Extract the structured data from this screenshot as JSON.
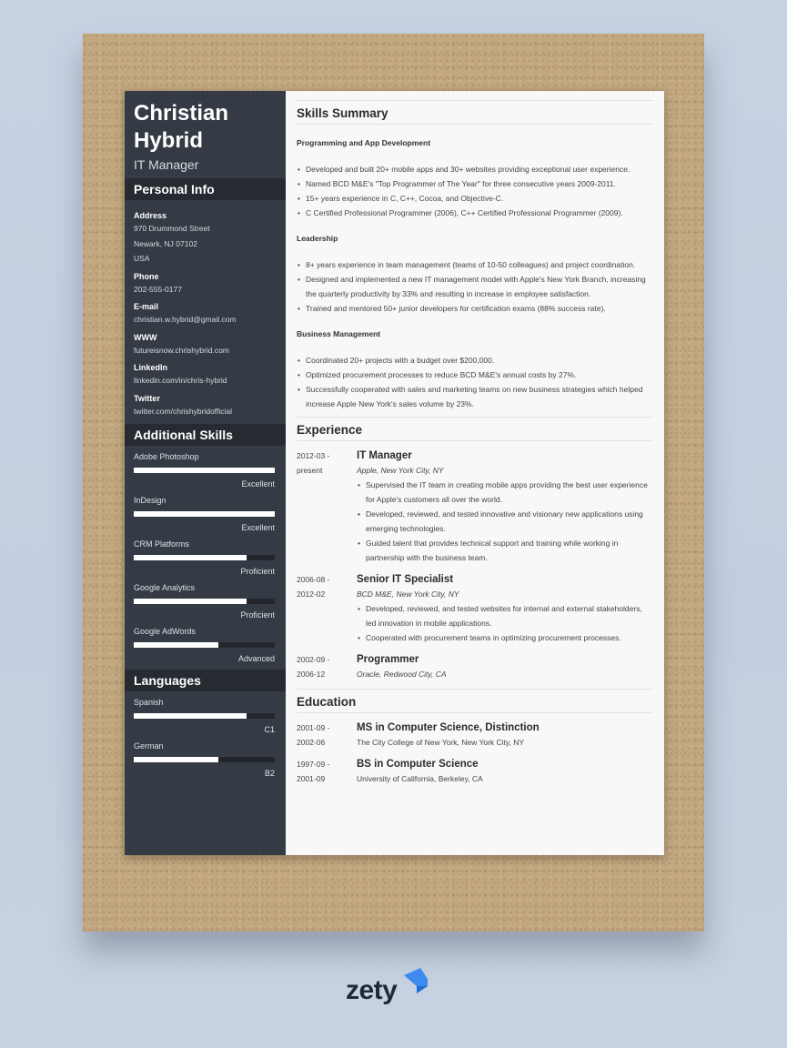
{
  "resume": {
    "name_line1": "Christian",
    "name_line2": "Hybrid",
    "role": "IT Manager",
    "personal_info": {
      "heading": "Personal Info",
      "fields": [
        {
          "label": "Address",
          "values": [
            "970 Drummond Street",
            "Newark, NJ 07102",
            "USA"
          ]
        },
        {
          "label": "Phone",
          "values": [
            "202-555-0177"
          ]
        },
        {
          "label": "E-mail",
          "values": [
            "christian.w.hybrid@gmail.com"
          ]
        },
        {
          "label": "WWW",
          "values": [
            "futureisnow.chrishybrid.com"
          ]
        },
        {
          "label": "LinkedIn",
          "values": [
            "linkedin.com/in/chris-hybrid"
          ]
        },
        {
          "label": "Twitter",
          "values": [
            "twitter.com/chrishybridofficial"
          ]
        }
      ]
    },
    "additional_skills": {
      "heading": "Additional Skills",
      "items": [
        {
          "name": "Adobe Photoshop",
          "level": "Excellent",
          "fraction": 1.0
        },
        {
          "name": "InDesign",
          "level": "Excellent",
          "fraction": 1.0
        },
        {
          "name": "CRM Platforms",
          "level": "Proficient",
          "fraction": 0.8
        },
        {
          "name": "Google Analytics",
          "level": "Proficient",
          "fraction": 0.8
        },
        {
          "name": "Google AdWords",
          "level": "Advanced",
          "fraction": 0.6
        }
      ]
    },
    "languages": {
      "heading": "Languages",
      "items": [
        {
          "name": "Spanish",
          "level": "C1",
          "fraction": 0.8
        },
        {
          "name": "German",
          "level": "B2",
          "fraction": 0.6
        }
      ]
    },
    "skills_summary": {
      "heading": "Skills Summary",
      "groups": [
        {
          "title": "Programming and App Development",
          "bullets": [
            "Developed and built 20+ mobile apps and 30+ websites providing exceptional user experience.",
            "Named BCD M&E's \"Top Programmer of The Year\" for three consecutive years 2009-2011.",
            "15+ years experience in C, C++, Cocoa, and Objective-C.",
            "C Certified Professional Programmer (2006), C++ Certified Professional Programmer (2009)."
          ]
        },
        {
          "title": "Leadership",
          "bullets": [
            "8+ years experience in team management (teams of 10-50 colleagues) and project coordination.",
            "Designed and implemented a new IT management model with Apple's New York Branch, increasing the quarterly productivity by 33% and resulting in increase in employee satisfaction.",
            "Trained and mentored 50+ junior developers for certification exams (88% success rate)."
          ]
        },
        {
          "title": "Business Management",
          "bullets": [
            "Coordinated 20+ projects with a budget over $200,000.",
            "Optimized procurement processes to reduce BCD M&E's annual costs by 27%.",
            "Successfully cooperated with sales and marketing teams on new business strategies which helped increase Apple New York's sales volume by 23%."
          ]
        }
      ]
    },
    "experience": {
      "heading": "Experience",
      "items": [
        {
          "date_from": "2012-03 -",
          "date_to": "present",
          "title": "IT Manager",
          "org": "Apple, New York City, NY",
          "bullets": [
            "Supervised the IT team in creating mobile apps providing the best user experience for Apple's customers all over the world.",
            "Developed, reviewed, and tested innovative and visionary new applications using emerging technologies.",
            "Guided talent that provides technical support and training while working in partnership with the business team."
          ]
        },
        {
          "date_from": "2006-08 -",
          "date_to": "2012-02",
          "title": "Senior IT Specialist",
          "org": "BCD M&E, New York City, NY",
          "bullets": [
            "Developed, reviewed, and tested websites for internal and external stakeholders, led innovation in mobile applications.",
            "Cooperated with procurement teams in optimizing procurement processes."
          ]
        },
        {
          "date_from": "2002-09 -",
          "date_to": "2006-12",
          "title": "Programmer",
          "org": "Oracle, Redwood City, CA",
          "bullets": []
        }
      ]
    },
    "education": {
      "heading": "Education",
      "items": [
        {
          "date_from": "2001-09 -",
          "date_to": "2002-06",
          "title": "MS in Computer Science, Distinction",
          "org": "The City College of New York, New York City, NY"
        },
        {
          "date_from": "1997-09 -",
          "date_to": "2001-09",
          "title": "BS in Computer Science",
          "org": "University of California, Berkeley, CA"
        }
      ]
    }
  },
  "brand": {
    "logo_text": "zety",
    "logo_color": "#1f2a3a",
    "accent_color": "#2f7de1"
  }
}
